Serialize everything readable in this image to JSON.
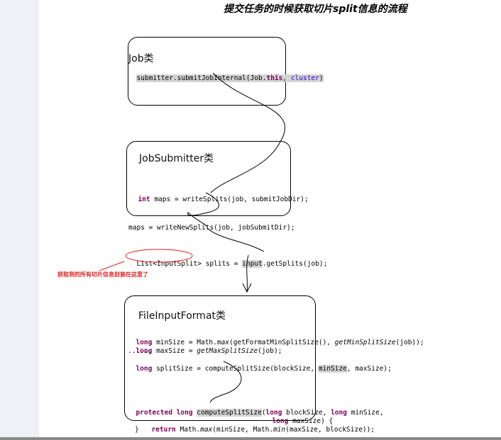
{
  "title": "提交任务的时候获取切片split信息的流程",
  "job_box": {
    "title": "Job类",
    "code": {
      "prefix": "submitter.submitJobInternal(Job.",
      "kw_this": "this",
      "mid": ", ",
      "arg": "cluster",
      "suffix": ")"
    }
  },
  "submitter_box": {
    "title": "JobSubmitter类",
    "code": {
      "kw_int": "int",
      "rest": " maps = writeSplits(job, submitJobDir);"
    }
  },
  "maps_line": "maps = writeNewSplits(job, jobSubmitDir);",
  "splits_line": {
    "type": "List<InputSplit>",
    "mid": " splits = ",
    "obj": "input",
    "rest": ".getSplits(job);"
  },
  "note": "获取到的所有切片信息封装在这里了",
  "fif_box": {
    "title": "FileInputFormat类",
    "line1": {
      "kw": "long",
      "a": " minSize = Math.",
      "m1": "max",
      "b": "(getFormatMinSplitSize(), ",
      "m2": "getMinSplitSize",
      "c": "(job));"
    },
    "line2": {
      "kw": "long",
      "a": " maxSize = ",
      "m1": "getMaxSplitSize",
      "b": "(job);"
    },
    "line3": "......",
    "line4": {
      "kw": "long",
      "a": " splitSize = computeSplitSize(blockSize, ",
      "hl": "minSize",
      "b": ", maxSize);"
    }
  },
  "method": {
    "kw1": "protected",
    "kw2": "long",
    "name": "computeSplitSize",
    "a": "(",
    "kw3": "long",
    "b": " blockSize, ",
    "kw4": "long",
    "c": " minSize,",
    "kw5": "long",
    "d": " maxSize) {",
    "kw6": "return",
    "e": " Math.",
    "m1": "max",
    "f": "(minSize, Math.",
    "m2": "min",
    "g": "(maxSize, blockSize));",
    "close": "}"
  }
}
